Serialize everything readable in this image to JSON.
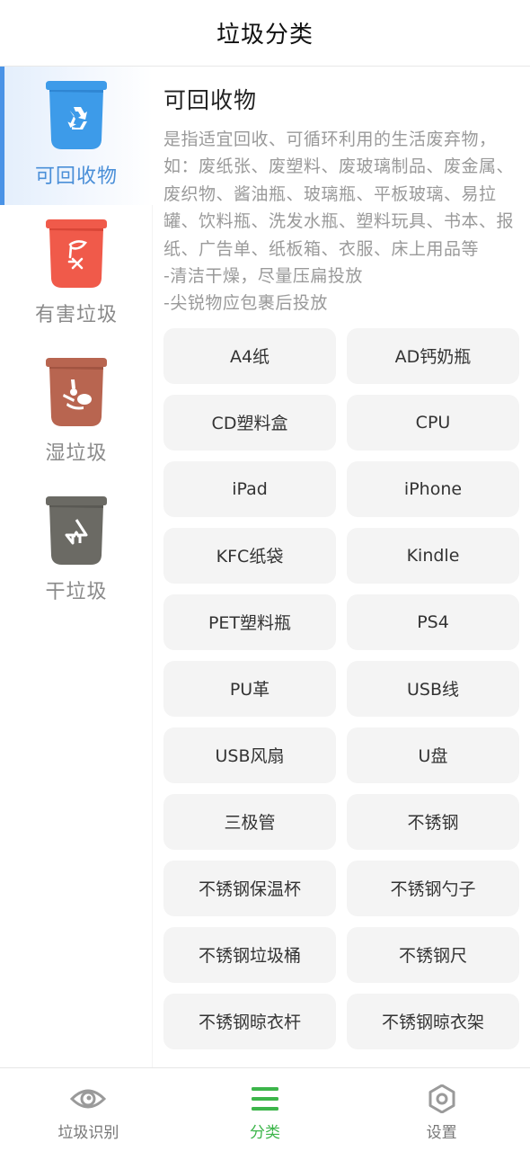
{
  "header": {
    "title": "垃圾分类"
  },
  "sidebar": {
    "items": [
      {
        "label": "可回收物",
        "icon": "recyclable-bin-icon",
        "color": "#3d9be9",
        "active": true
      },
      {
        "label": "有害垃圾",
        "icon": "hazardous-bin-icon",
        "color": "#f05a4a",
        "active": false
      },
      {
        "label": "湿垃圾",
        "icon": "wet-waste-bin-icon",
        "color": "#b86550",
        "active": false
      },
      {
        "label": "干垃圾",
        "icon": "dry-waste-bin-icon",
        "color": "#6b6a64",
        "active": false
      }
    ],
    "active_color": "#4a93e6"
  },
  "content": {
    "title": "可回收物",
    "description": "是指适宜回收、可循环利用的生活废弃物，如：废纸张、废塑料、废玻璃制品、废金属、废织物、酱油瓶、玻璃瓶、平板玻璃、易拉罐、饮料瓶、洗发水瓶、塑料玩具、书本、报纸、广告单、纸板箱、衣服、床上用品等\n-清洁干燥，尽量压扁投放\n-尖锐物应包裹后投放",
    "items": [
      "A4纸",
      "AD钙奶瓶",
      "CD塑料盒",
      "CPU",
      "iPad",
      "iPhone",
      "KFC纸袋",
      "Kindle",
      "PET塑料瓶",
      "PS4",
      "PU革",
      "USB线",
      "USB风扇",
      "U盘",
      "三极管",
      "不锈钢",
      "不锈钢保温杯",
      "不锈钢勺子",
      "不锈钢垃圾桶",
      "不锈钢尺",
      "不锈钢晾衣杆",
      "不锈钢晾衣架"
    ]
  },
  "bottom_nav": {
    "items": [
      {
        "label": "垃圾识别",
        "icon": "eye-icon",
        "active": false
      },
      {
        "label": "分类",
        "icon": "list-menu-icon",
        "active": true
      },
      {
        "label": "设置",
        "icon": "settings-hexagon-icon",
        "active": false
      }
    ],
    "active_color": "#3cb54a",
    "inactive_color": "#9a9a9a"
  }
}
